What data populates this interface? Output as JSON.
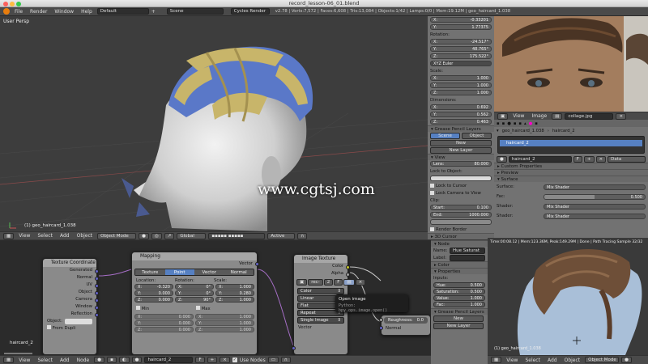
{
  "window": {
    "title": "record_lesson-06_01.blend"
  },
  "topbar": {
    "menus": [
      "File",
      "Render",
      "Window",
      "Help"
    ],
    "layout": "Default",
    "scene": "Scene",
    "engine": "Cycles Render",
    "stats": "v2.78 | Verts:7,572 | Faces:6,608 | Tris:13,084 | Objects:1/42 | Lamps:0/0 | Mem:19.12M | geo_haircard_1.038"
  },
  "viewport": {
    "label": "User Persp",
    "object_label": "(1) geo_haircard_1.038",
    "watermark": "www.cgtsj.com",
    "header": {
      "items": [
        "View",
        "Select",
        "Add",
        "Object"
      ],
      "mode": "Object Mode",
      "orientation": "Global",
      "layer": "Active"
    }
  },
  "properties": {
    "location": {
      "label": "",
      "x": "-0.33201",
      "y": "1.77375",
      "z": ""
    },
    "rotation": {
      "label": "Rotation:",
      "x": "-24.517°",
      "y": "48.765°",
      "z": "175.522°",
      "mode": "XYZ Euler"
    },
    "scale": {
      "label": "Scale:",
      "x": "1.000",
      "y": "1.000",
      "z": "1.000"
    },
    "dimensions": {
      "label": "Dimensions:",
      "x": "0.692",
      "y": "0.562",
      "z": "0.463"
    },
    "gpencil": {
      "title": "Grease Pencil Layers",
      "tabs": [
        "Scene",
        "Object"
      ],
      "new": "New",
      "new_layer": "New Layer"
    },
    "view": {
      "title": "View",
      "lens_label": "Lens:",
      "lens": "80.000",
      "lock_label": "Lock to Object:",
      "lock_cursor": "Lock to Cursor",
      "lock_camera": "Lock Camera to View",
      "clip": "Clip:",
      "start_label": "Start:",
      "start": "0.100",
      "end_label": "End:",
      "end": "1000.000",
      "render_border": "Render Border",
      "cursor": "3D Cursor"
    }
  },
  "image_editor": {
    "menus": [
      "View",
      "Image"
    ],
    "image": "collage.jpg",
    "mesh": "haircard_2",
    "object": "geo_haircard_1.038"
  },
  "material": {
    "slot": "haircard_2",
    "data": "Data",
    "sections": [
      "Custom Properties",
      "Preview",
      "Surface"
    ],
    "surface_label": "Surface:",
    "surface": "Mix Shader",
    "fac_label": "Fac:",
    "fac": "0.500",
    "fac_fraction": 0.5,
    "shader_label": "Shader:",
    "shader1": "Mix Shader",
    "shader2": "Mix Shader"
  },
  "node_editor": {
    "texcoord": {
      "title": "Texture Coordinate",
      "outputs": [
        "Generated",
        "Normal",
        "UV",
        "Object",
        "Camera",
        "Window",
        "Reflection"
      ],
      "object": "Object:",
      "from_dupli": "From Dupli"
    },
    "mapping": {
      "title": "Mapping",
      "vector": "Vector",
      "tabs": [
        "Texture",
        "Point",
        "Vector",
        "Normal"
      ],
      "active": "Point",
      "cols": [
        "Location:",
        "Rotation:",
        "Scale:"
      ],
      "loc": [
        "-0.320",
        "0.000",
        "0.000"
      ],
      "rot": [
        "0°",
        "0°",
        "90°"
      ],
      "scale": [
        "1.000",
        "0.280",
        "1.000"
      ],
      "min": "Min",
      "max": "Max",
      "min_vals": [
        "0.000",
        "0.000",
        "0.000"
      ],
      "max_vals": [
        "1.000",
        "1.000",
        "1.000"
      ]
    },
    "image_texture": {
      "title": "Image Texture",
      "outputs": [
        "Color",
        "Alpha"
      ],
      "image": "rec-",
      "img_num": "2",
      "dropdowns": [
        "Color",
        "Linear",
        "Flat",
        "Repeat",
        "Single Image"
      ],
      "vector_in": "Vector"
    },
    "roughness": "Roughness:",
    "roughness_val": "0.0",
    "normal": "Normal",
    "tooltip": {
      "title": "Open image",
      "python": "Python: bpy.ops.image.open()"
    },
    "hair_label": "haircard_2",
    "header": {
      "items": [
        "View",
        "Select",
        "Add",
        "Node"
      ],
      "material": "haircard_2",
      "use_nodes": "Use Nodes"
    }
  },
  "node_props": {
    "title": "Node",
    "name_label": "Name:",
    "name": "Hue Saturat",
    "label_label": "Label:",
    "color": "Color",
    "properties": "Properties",
    "inputs": "Inputs:",
    "hue_label": "Hue:",
    "hue": "0.500",
    "sat_label": "Saturation:",
    "sat": "0.500",
    "val_label": "Value:",
    "val": "1.000",
    "fac_label": "Fac:",
    "fac": "1.000",
    "gp": "Grease Pencil Layers",
    "new": "New",
    "new_layer": "New Layer"
  },
  "render_view": {
    "status": "Time:00:08.12 | Mem:123.36M, Peak:149.29M | Done | Path Tracing Sample 32/32",
    "object": "(1) geo_haircard_1.038",
    "header": {
      "items": [
        "View",
        "Select",
        "Add",
        "Object"
      ],
      "mode": "Object Mode"
    }
  }
}
